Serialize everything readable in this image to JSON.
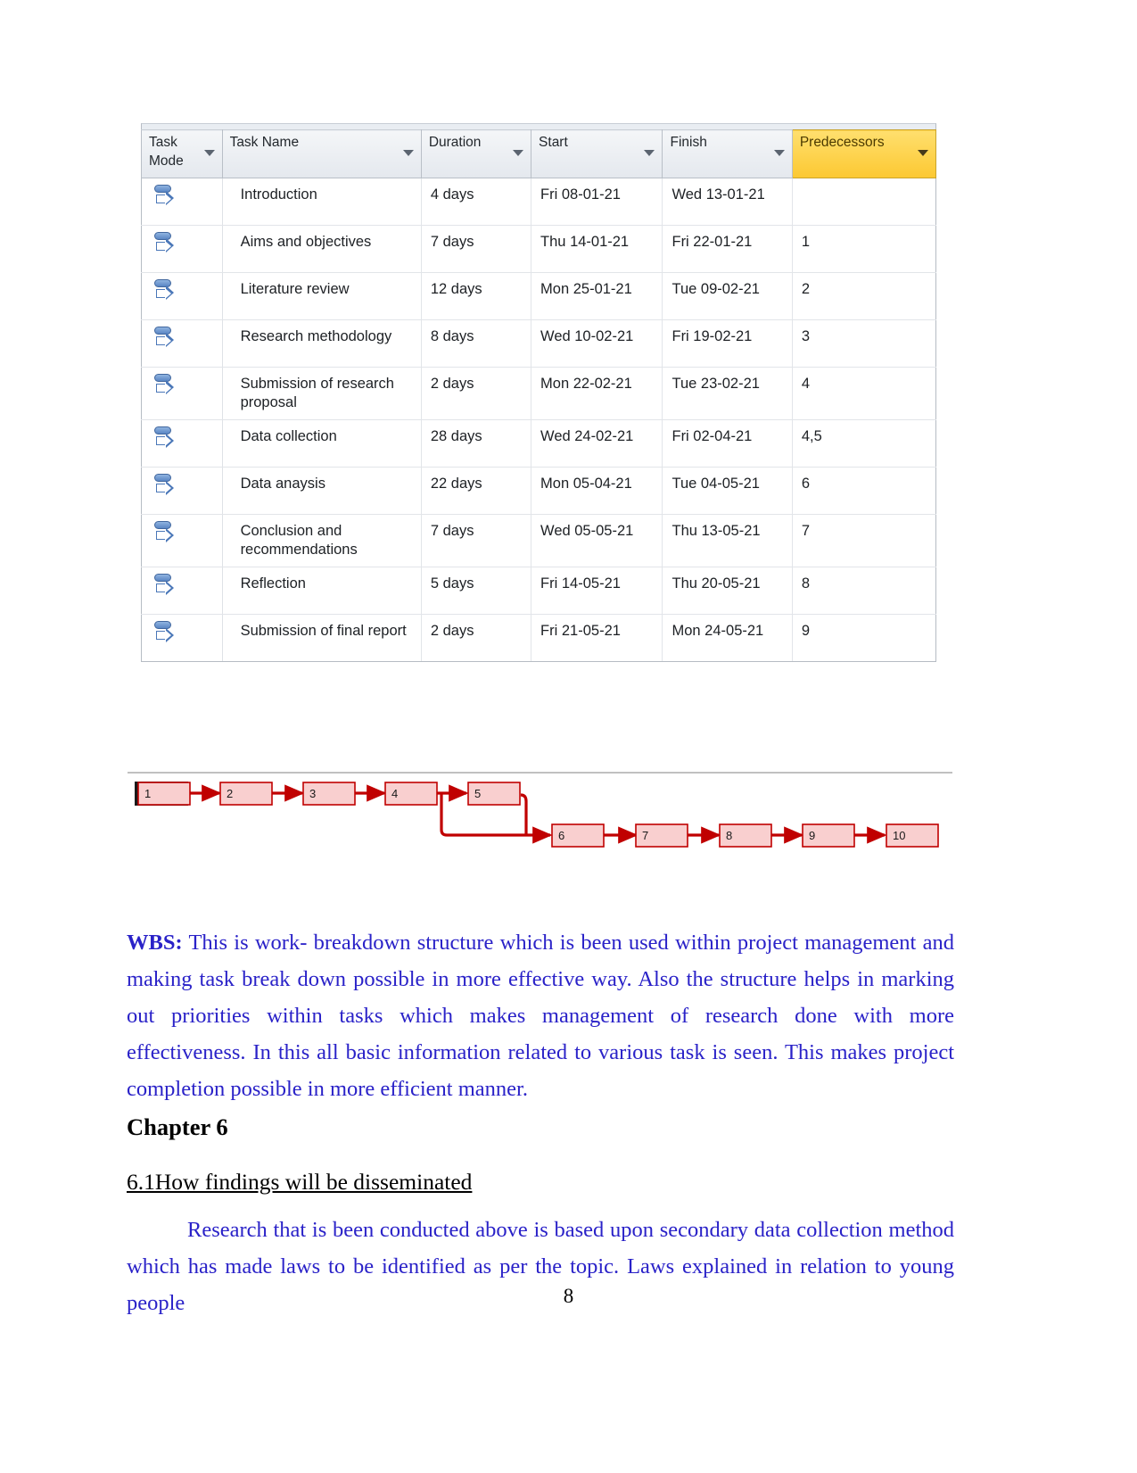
{
  "document": {
    "page_number": "8"
  },
  "gantt": {
    "columns": [
      {
        "label": "Task Mode",
        "key": "task_mode",
        "highlighted": false
      },
      {
        "label": "Task Name",
        "key": "task_name",
        "highlighted": false
      },
      {
        "label": "Duration",
        "key": "duration",
        "highlighted": false
      },
      {
        "label": "Start",
        "key": "start",
        "highlighted": false
      },
      {
        "label": "Finish",
        "key": "finish",
        "highlighted": false
      },
      {
        "label": "Predecessors",
        "key": "predecessors",
        "highlighted": true
      }
    ],
    "highlight_color": "#fcc831",
    "sort_icon": "chevron-down-icon",
    "task_mode_icon": "manually-scheduled-icon",
    "rows": [
      {
        "task_name": "Introduction",
        "duration": "4 days",
        "start": "Fri 08-01-21",
        "finish": "Wed 13-01-21",
        "predecessors": ""
      },
      {
        "task_name": "Aims and objectives",
        "duration": "7 days",
        "start": "Thu 14-01-21",
        "finish": "Fri 22-01-21",
        "predecessors": "1"
      },
      {
        "task_name": "Literature review",
        "duration": "12 days",
        "start": "Mon 25-01-21",
        "finish": "Tue 09-02-21",
        "predecessors": "2"
      },
      {
        "task_name": "Research methodology",
        "duration": "8 days",
        "start": "Wed 10-02-21",
        "finish": "Fri 19-02-21",
        "predecessors": "3"
      },
      {
        "task_name": "Submission of research proposal",
        "duration": "2 days",
        "start": "Mon 22-02-21",
        "finish": "Tue 23-02-21",
        "predecessors": "4"
      },
      {
        "task_name": "Data collection",
        "duration": "28 days",
        "start": "Wed 24-02-21",
        "finish": "Fri 02-04-21",
        "predecessors": "4,5"
      },
      {
        "task_name": "Data anaysis",
        "duration": "22 days",
        "start": "Mon 05-04-21",
        "finish": "Tue 04-05-21",
        "predecessors": "6"
      },
      {
        "task_name": "Conclusion and recommendations",
        "duration": "7 days",
        "start": "Wed 05-05-21",
        "finish": "Thu 13-05-21",
        "predecessors": "7"
      },
      {
        "task_name": "Reflection",
        "duration": "5 days",
        "start": "Fri 14-05-21",
        "finish": "Thu 20-05-21",
        "predecessors": "8"
      },
      {
        "task_name": "Submission of final report",
        "duration": "2 days",
        "start": "Fri 21-05-21",
        "finish": "Mon 24-05-21",
        "predecessors": "9"
      }
    ]
  },
  "network_diagram": {
    "node_fill": "#f9cfcf",
    "node_border": "#c00000",
    "connector_color": "#c00000",
    "nodes_top": [
      "1",
      "2",
      "3",
      "4",
      "5"
    ],
    "nodes_bottom": [
      "6",
      "7",
      "8",
      "9",
      "10"
    ],
    "critical_node": "1"
  },
  "text": {
    "wbs_label": "WBS:",
    "wbs_paragraph": " This is work- breakdown structure which is been used within project management and making task break down possible in more effective way. Also the structure helps in marking out priorities within tasks which makes management of research done with more effectiveness. In this all basic information related to various task is seen. This makes project completion possible in more efficient manner.",
    "chapter_heading": "Chapter 6",
    "section_heading": "6.1How findings will be disseminated ",
    "findings_paragraph": "Research that is been conducted above is based upon secondary data collection method which has made laws to be identified as per the topic. Laws explained in relation to young people"
  }
}
